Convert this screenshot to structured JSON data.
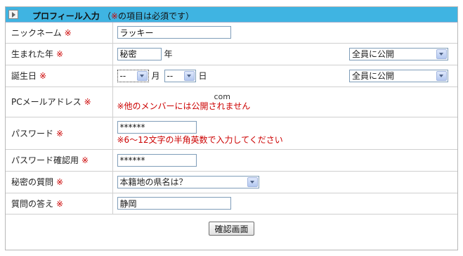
{
  "header": {
    "title": "プロフィール入力",
    "note_open": "（",
    "note_mark": "※",
    "note_rest": "の項目は必須です）"
  },
  "required_mark": "※",
  "fields": {
    "nickname": {
      "label": "ニックネーム",
      "value": "ラッキー"
    },
    "birth_year": {
      "label": "生まれた年",
      "value": "秘密",
      "unit": "年",
      "visibility": "全員に公開"
    },
    "birthday": {
      "label": "誕生日",
      "month_value": "--",
      "month_unit": "月",
      "day_value": "--",
      "day_unit": "日",
      "visibility": "全員に公開"
    },
    "pc_email": {
      "label": "PCメールアドレス",
      "value": "com",
      "note": "※他のメンバーには公開されません"
    },
    "password": {
      "label": "パスワード",
      "value": "******",
      "note": "※6～12文字の半角英数で入力してください"
    },
    "password_confirm": {
      "label": "パスワード確認用",
      "value": "******"
    },
    "secret_question": {
      "label": "秘密の質問",
      "value": "本籍地の県名は？"
    },
    "answer": {
      "label": "質問の答え",
      "value": "静岡"
    }
  },
  "confirm_button": "確認画面",
  "colors": {
    "header_bg": "#3fb4e2",
    "required": "#cc0000",
    "border": "#cfcfcf"
  }
}
